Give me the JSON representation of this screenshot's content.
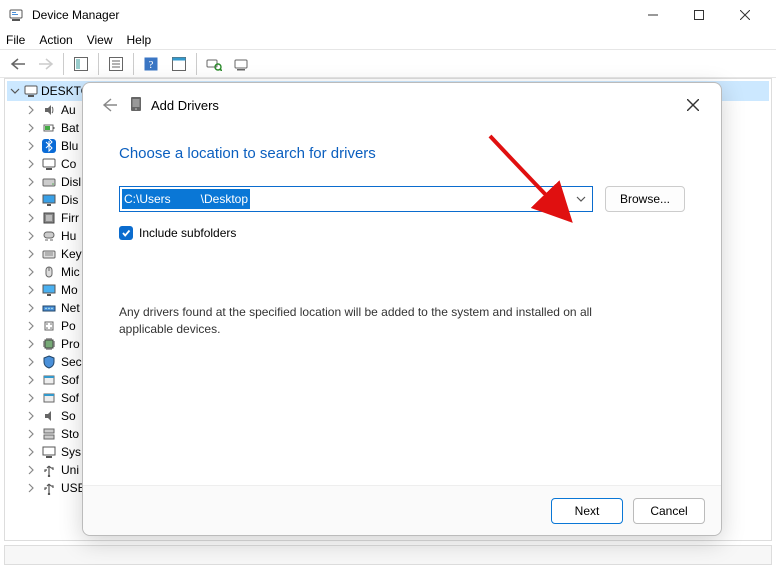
{
  "window": {
    "title": "Device Manager"
  },
  "menu": {
    "file": "File",
    "action": "Action",
    "view": "View",
    "help": "Help"
  },
  "tree": {
    "root": "DESKTO",
    "items": [
      {
        "label": "Au",
        "icon": "audio"
      },
      {
        "label": "Bat",
        "icon": "battery"
      },
      {
        "label": "Blu",
        "icon": "bluetooth"
      },
      {
        "label": "Co",
        "icon": "computer"
      },
      {
        "label": "Disl",
        "icon": "disk"
      },
      {
        "label": "Dis",
        "icon": "display"
      },
      {
        "label": "Firr",
        "icon": "firmware"
      },
      {
        "label": "Hu",
        "icon": "hid"
      },
      {
        "label": "Key",
        "icon": "keyboard"
      },
      {
        "label": "Mic",
        "icon": "mouse"
      },
      {
        "label": "Mo",
        "icon": "monitor"
      },
      {
        "label": "Net",
        "icon": "network"
      },
      {
        "label": "Po",
        "icon": "port"
      },
      {
        "label": "Pro",
        "icon": "processor"
      },
      {
        "label": "Sec",
        "icon": "security"
      },
      {
        "label": "Sof",
        "icon": "software"
      },
      {
        "label": "Sof",
        "icon": "software"
      },
      {
        "label": "So",
        "icon": "sound"
      },
      {
        "label": "Sto",
        "icon": "storage"
      },
      {
        "label": "Sys",
        "icon": "system"
      },
      {
        "label": "Uni",
        "icon": "usb"
      },
      {
        "label": "USE",
        "icon": "usb"
      }
    ]
  },
  "dialog": {
    "title": "Add Drivers",
    "heading": "Choose a location to search for drivers",
    "path_prefix": "C:\\Users",
    "path_suffix": "\\Desktop",
    "browse": "Browse...",
    "include_subfolders": "Include subfolders",
    "description": "Any drivers found at the specified location will be added to the system and installed on all applicable devices.",
    "next": "Next",
    "cancel": "Cancel"
  }
}
